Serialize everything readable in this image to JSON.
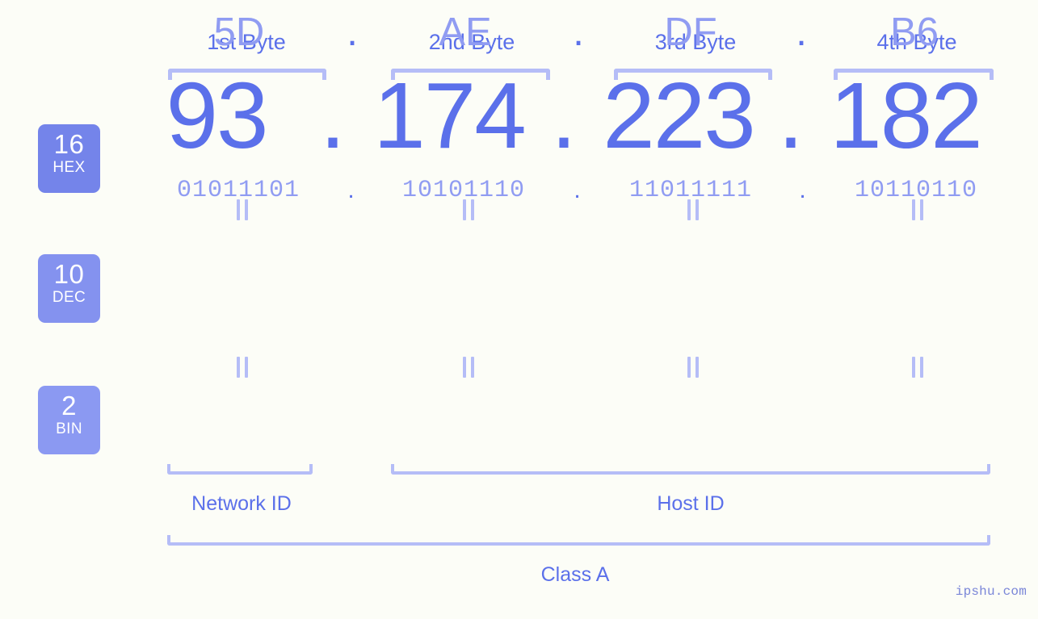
{
  "theme": {
    "background": "#fcfdf7",
    "accent_strong": "#5b70ea",
    "accent_light": "#909cf2",
    "bracket": "#b5bdf7",
    "badge_hex": "#7484ea",
    "badge_dec": "#8492ef",
    "badge_bin": "#8b99f2",
    "badge_text": "#ffffff"
  },
  "byte_headers": [
    {
      "label": "1st Byte"
    },
    {
      "label": "2nd Byte"
    },
    {
      "label": "3rd Byte"
    },
    {
      "label": "4th Byte"
    }
  ],
  "bases": [
    {
      "number": "16",
      "name": "HEX"
    },
    {
      "number": "10",
      "name": "DEC"
    },
    {
      "number": "2",
      "name": "BIN"
    }
  ],
  "separator": ".",
  "equality_symbol": "=",
  "rows": {
    "hex": {
      "base_number": "16",
      "base_name": "HEX",
      "values": [
        "5D",
        "AE",
        "DF",
        "B6"
      ]
    },
    "dec": {
      "base_number": "10",
      "base_name": "DEC",
      "values": [
        "93",
        "174",
        "223",
        "182"
      ]
    },
    "bin": {
      "base_number": "2",
      "base_name": "BIN",
      "values": [
        "01011101",
        "10101110",
        "11011111",
        "10110110"
      ]
    }
  },
  "addresses": {
    "hex": "5D.AE.DF.B6",
    "dec": "93.174.223.182",
    "bin": "01011101.10101110.11011111.10110110"
  },
  "sections": [
    {
      "label": "Network ID"
    },
    {
      "label": "Host ID"
    }
  ],
  "class_label": "Class A",
  "watermark": "ipshu.com"
}
